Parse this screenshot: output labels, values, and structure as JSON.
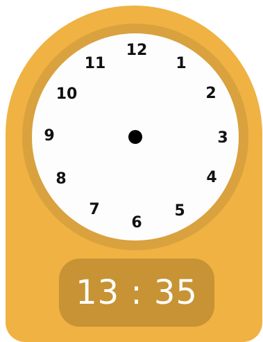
{
  "clock": {
    "numerals": [
      "12",
      "1",
      "2",
      "3",
      "4",
      "5",
      "6",
      "7",
      "8",
      "9",
      "10",
      "11"
    ],
    "digital_time": "13 : 35"
  },
  "colors": {
    "body": "#EFB243",
    "ring": "#D9A23E",
    "face": "#FDFDFD",
    "digital_panel": "#C79334",
    "numerals": "#111111",
    "digital_text": "#FFFFFF"
  }
}
